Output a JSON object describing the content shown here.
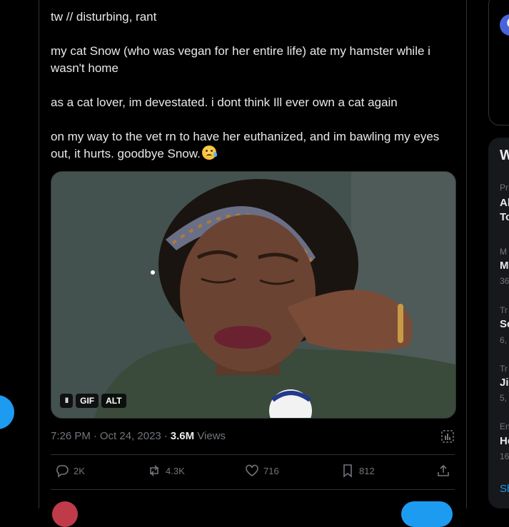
{
  "tweet": {
    "lines": [
      "tw // disturbing, rant",
      "my cat Snow (who was vegan for her entire life) ate my hamster while i wasn't home",
      "as a cat lover, im devestated. i dont think Ill ever own a cat again",
      "on my way to the vet rn to have her euthanized, and im bawling my eyes out, it hurts. goodbye Snow."
    ],
    "emoji": "crying-face"
  },
  "media": {
    "type": "gif",
    "pause_label": "II",
    "gif_label": "GIF",
    "alt_label": "ALT"
  },
  "meta": {
    "time": "7:26 PM",
    "date": "Oct 24, 2023",
    "views_count": "3.6M",
    "views_label": "Views"
  },
  "actions": {
    "replies": "2K",
    "reposts": "4.3K",
    "likes": "716",
    "bookmarks": "812"
  },
  "sidebar": {
    "heading": "W",
    "trends": [
      {
        "category": "Pr",
        "title": "Al",
        "title2": "To"
      },
      {
        "category": "M",
        "title": "M",
        "count": "36"
      },
      {
        "category": "Tr",
        "title": "Sc",
        "count": "6,"
      },
      {
        "category": "Tr",
        "title": "Jir",
        "count": "5,"
      },
      {
        "category": "En",
        "title": "He",
        "count": "16"
      }
    ],
    "show_more": "Sh"
  },
  "colors": {
    "background": "#000000",
    "text": "#e7e9ea",
    "muted": "#71767b",
    "accent": "#1d9bf0",
    "border": "#2f3336"
  }
}
